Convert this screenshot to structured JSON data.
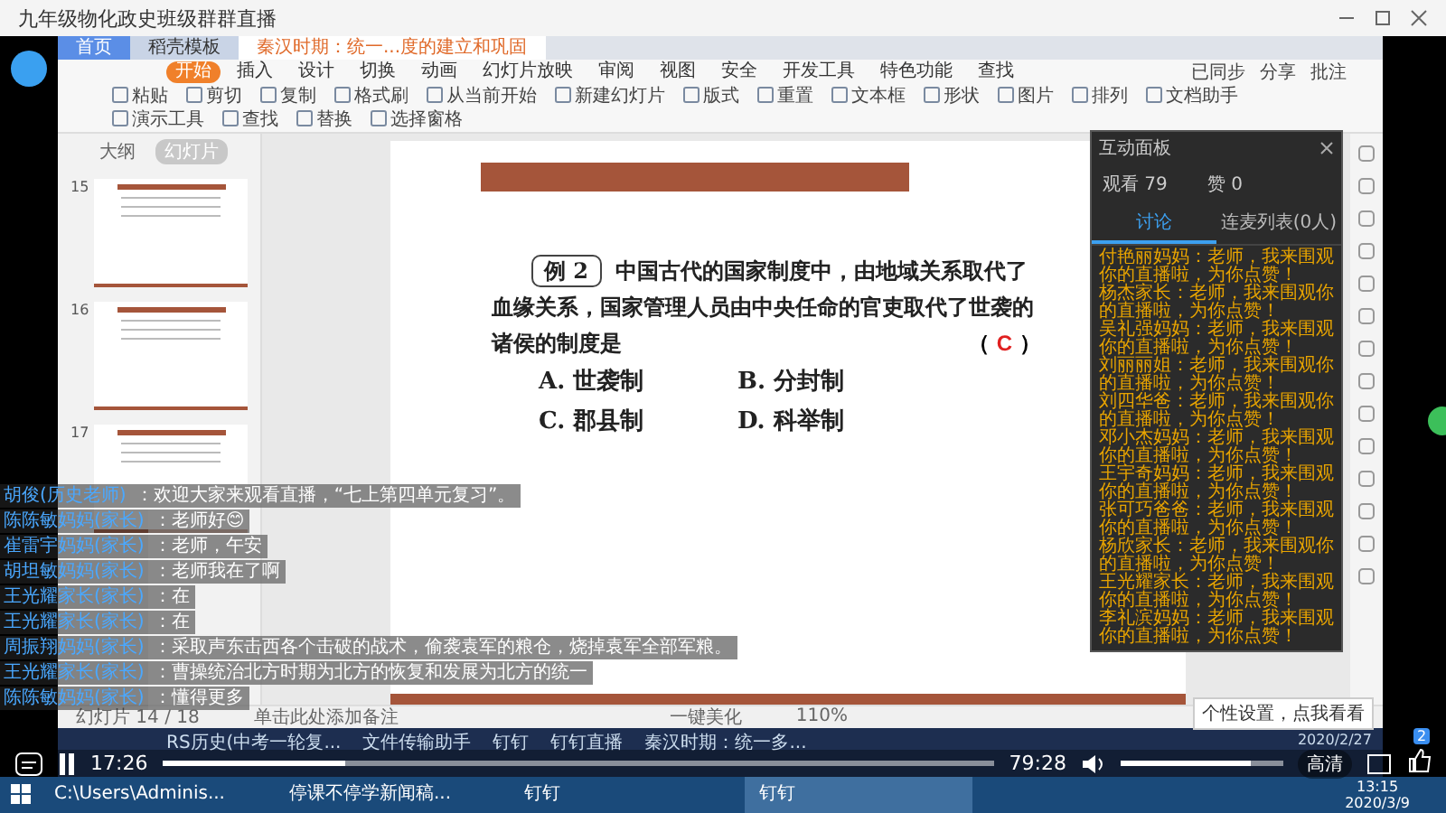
{
  "window": {
    "title": "九年级物化政史班级群群直播"
  },
  "wps": {
    "doc_tabs": [
      {
        "label": "首页",
        "selected": false
      },
      {
        "label": "稻壳模板",
        "selected": false
      },
      {
        "label": "秦汉时期：统一...度的建立和巩固",
        "selected": true
      }
    ],
    "ribbon_tabs": [
      {
        "label": "开始",
        "selected": true
      },
      {
        "label": "插入",
        "selected": false
      },
      {
        "label": "设计",
        "selected": false
      },
      {
        "label": "切换",
        "selected": false
      },
      {
        "label": "动画",
        "selected": false
      },
      {
        "label": "幻灯片放映",
        "selected": false
      },
      {
        "label": "审阅",
        "selected": false
      },
      {
        "label": "视图",
        "selected": false
      },
      {
        "label": "安全",
        "selected": false
      },
      {
        "label": "开发工具",
        "selected": false
      },
      {
        "label": "特色功能",
        "selected": false
      },
      {
        "label": "查找",
        "selected": false
      }
    ],
    "ribbon_right": [
      "已同步",
      "分享",
      "批注"
    ],
    "toolbar": [
      {
        "label": "粘贴"
      },
      {
        "label": "剪切"
      },
      {
        "label": "复制"
      },
      {
        "label": "格式刷"
      },
      {
        "label": "从当前开始"
      },
      {
        "label": "新建幻灯片"
      },
      {
        "label": "版式"
      },
      {
        "label": "重置"
      },
      {
        "label": "文本框"
      },
      {
        "label": "形状"
      },
      {
        "label": "图片"
      },
      {
        "label": "排列"
      },
      {
        "label": "文档助手"
      },
      {
        "label": "演示工具"
      },
      {
        "label": "查找"
      },
      {
        "label": "替换"
      },
      {
        "label": "选择窗格"
      }
    ],
    "panel_tabs": [
      {
        "label": "大纲",
        "selected": false
      },
      {
        "label": "幻灯片",
        "selected": true
      }
    ],
    "thumbnails": [
      {
        "number": "15"
      },
      {
        "number": "16"
      },
      {
        "number": "17"
      }
    ],
    "status": {
      "slide": "幻灯片 14 / 18",
      "notes": "单击此处添加备注",
      "beautify": "一键美化",
      "zoom": "110%"
    }
  },
  "slide": {
    "badge": "例 2",
    "question": "中国古代的国家制度中，由地域关系取代了血缘关系，国家管理人员由中央任命的官吏取代了世袭的诸侯的制度是",
    "paren_left": "（",
    "answer": "C",
    "paren_right": "）",
    "options": [
      "A. 世袭制",
      "B. 分封制",
      "C. 郡县制",
      "D. 科举制"
    ]
  },
  "interaction_panel": {
    "title": "互动面板",
    "views": "观看 79",
    "likes": "赞 0",
    "tabs": [
      {
        "label": "讨论",
        "selected": true
      },
      {
        "label": "连麦列表(0人)",
        "selected": false
      }
    ],
    "messages": [
      "付艳丽妈妈：老师，我来围观你的直播啦，为你点赞！",
      "杨杰家长：老师，我来围观你的直播啦，为你点赞！",
      "吴礼强妈妈：老师，我来围观你的直播啦，为你点赞！",
      "刘丽丽姐：老师，我来围观你的直播啦，为你点赞！",
      "刘四华爸：老师，我来围观你的直播啦，为你点赞！",
      "邓小杰妈妈：老师，我来围观你的直播啦，为你点赞！",
      "王宇奇妈妈：老师，我来围观你的直播啦，为你点赞！",
      "张可巧爸爸：老师，我来围观你的直播啦，为你点赞！",
      "杨欣家长：老师，我来围观你的直播啦，为你点赞！",
      "王光耀家长：老师，我来围观你的直播啦，为你点赞！",
      "李礼滨妈妈：老师，我来围观你的直播啦，为你点赞！"
    ]
  },
  "chat": [
    {
      "name": "胡俊(历史老师)",
      "text": "：欢迎大家来观看直播，“七上第四单元复习”。"
    },
    {
      "name": "陈陈敏妈妈(家长)",
      "text": "：老师好😊"
    },
    {
      "name": "崔雷宇妈妈(家长)",
      "text": "：老师，午安"
    },
    {
      "name": "胡坦敏妈妈(家长)",
      "text": "：老师我在了啊"
    },
    {
      "name": "王光耀家长(家长)",
      "text": "：在"
    },
    {
      "name": "王光耀家长(家长)",
      "text": "：在"
    },
    {
      "name": "周振翔妈妈(家长)",
      "text": "：采取声东击西各个击破的战术，偷袭袁军的粮仓，烧掉袁军全部军粮。"
    },
    {
      "name": "王光耀家长(家长)",
      "text": "：曹操统治北方时期为北方的恢复和发展为北方的统一"
    },
    {
      "name": "陈陈敏妈妈(家长)",
      "text": "：懂得更多"
    }
  ],
  "video": {
    "current": "17:26",
    "total": "79:28",
    "progress": {
      "level": 0.22
    },
    "volume": {
      "level": 0.8
    },
    "quality": "高清",
    "like_count": "2",
    "tooltip": "个性设置，点我看看"
  },
  "remote_taskbar": {
    "items": [
      "RS历史(中考一轮复...",
      "文件传输助手",
      "钉钉",
      "钉钉直播",
      "秦汉时期：统一多..."
    ],
    "date": "2020/2/27"
  },
  "taskbar": {
    "items": [
      {
        "label": "C:\\Users\\Adminis...",
        "selected": false
      },
      {
        "label": "停课不停学新闻稿...",
        "selected": false
      },
      {
        "label": "钉钉",
        "selected": false
      },
      {
        "label": "钉钉",
        "selected": true
      }
    ],
    "time": "13:15",
    "date": "2020/3/9"
  }
}
